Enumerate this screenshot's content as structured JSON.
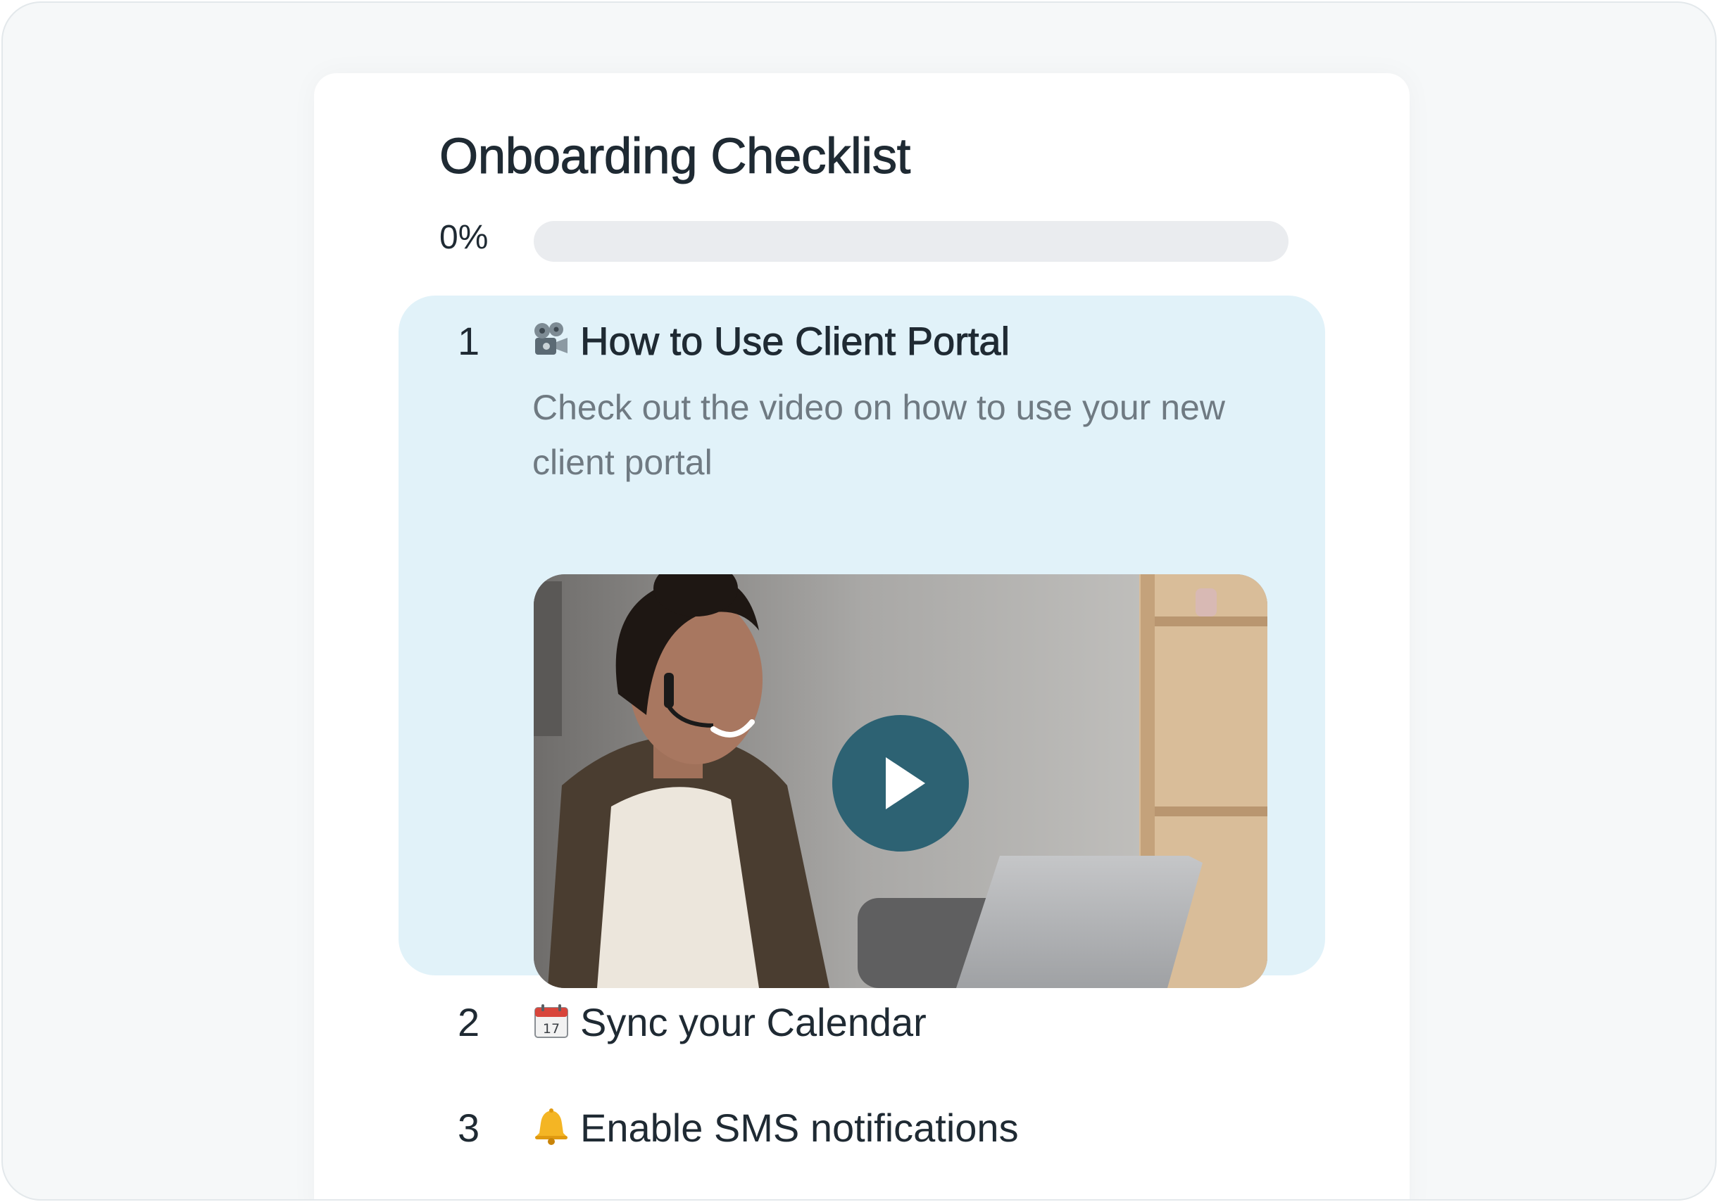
{
  "checklist": {
    "title": "Onboarding Checklist",
    "progress_label": "0%",
    "progress_value": 0,
    "accent_color": "#2d6273",
    "active_bg_color": "#e1f2f9",
    "steps": [
      {
        "number": "1",
        "icon": "film-projector-icon",
        "title": "How to Use Client Portal",
        "description": "Check out the video on how to use your new client portal",
        "video": {
          "thumbnail": "woman-with-headset-at-laptop",
          "play_icon": "play-icon"
        }
      },
      {
        "number": "2",
        "icon": "calendar-icon",
        "title": "Sync your Calendar"
      },
      {
        "number": "3",
        "icon": "bell-icon",
        "title": "Enable SMS notifications"
      }
    ]
  }
}
